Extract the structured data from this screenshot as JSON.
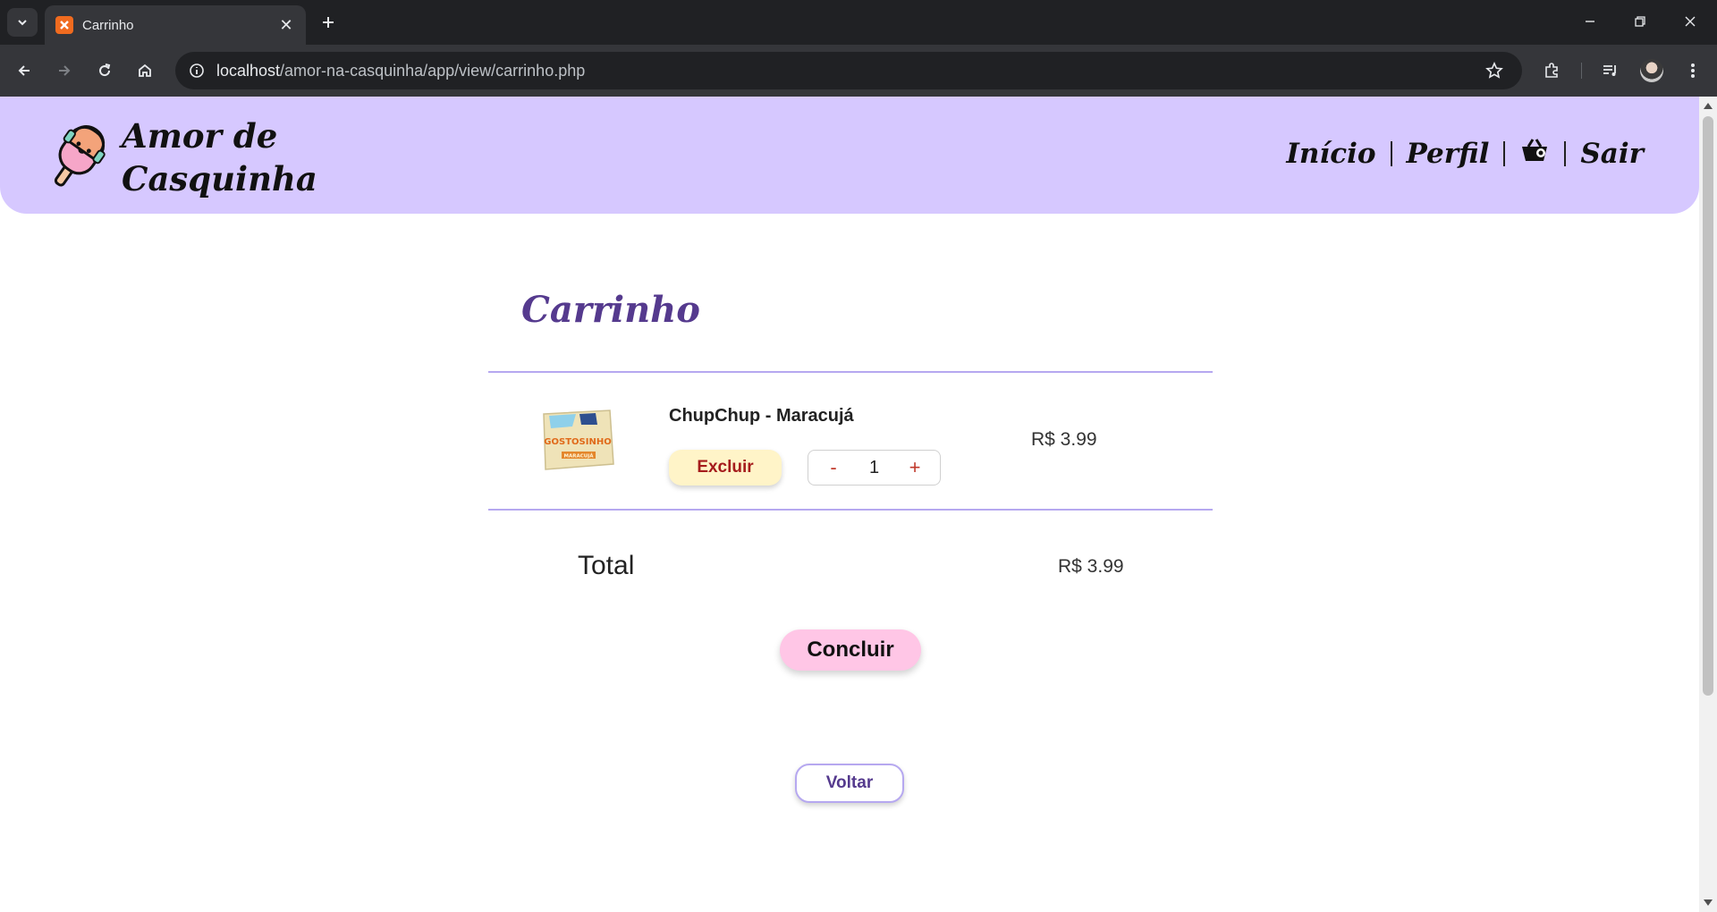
{
  "browser": {
    "tab_title": "Carrinho",
    "url_host": "localhost",
    "url_path": "/amor-na-casquinha/app/view/carrinho.php"
  },
  "header": {
    "brand_line1": "Amor de",
    "brand_line2": "Casquinha",
    "nav": {
      "inicio": "Início",
      "perfil": "Perfil",
      "sair": "Sair"
    }
  },
  "cart": {
    "title": "Carrinho",
    "items": [
      {
        "name": "ChupChup - Maracujá",
        "remove_label": "Excluir",
        "minus_label": "-",
        "quantity": "1",
        "plus_label": "+",
        "price": "R$ 3.99",
        "image_text": "GOSTOSINHO",
        "image_subtext": "MARACUJÁ"
      }
    ],
    "total_label": "Total",
    "total_value": "R$ 3.99",
    "conclude_label": "Concluir",
    "back_label": "Voltar"
  },
  "colors": {
    "header_bg": "#d6c8ff",
    "title_purple": "#553a8e",
    "divider": "#b6a8f0",
    "excluir_bg": "#fff4c8",
    "concluir_bg": "#ffc6e6"
  }
}
